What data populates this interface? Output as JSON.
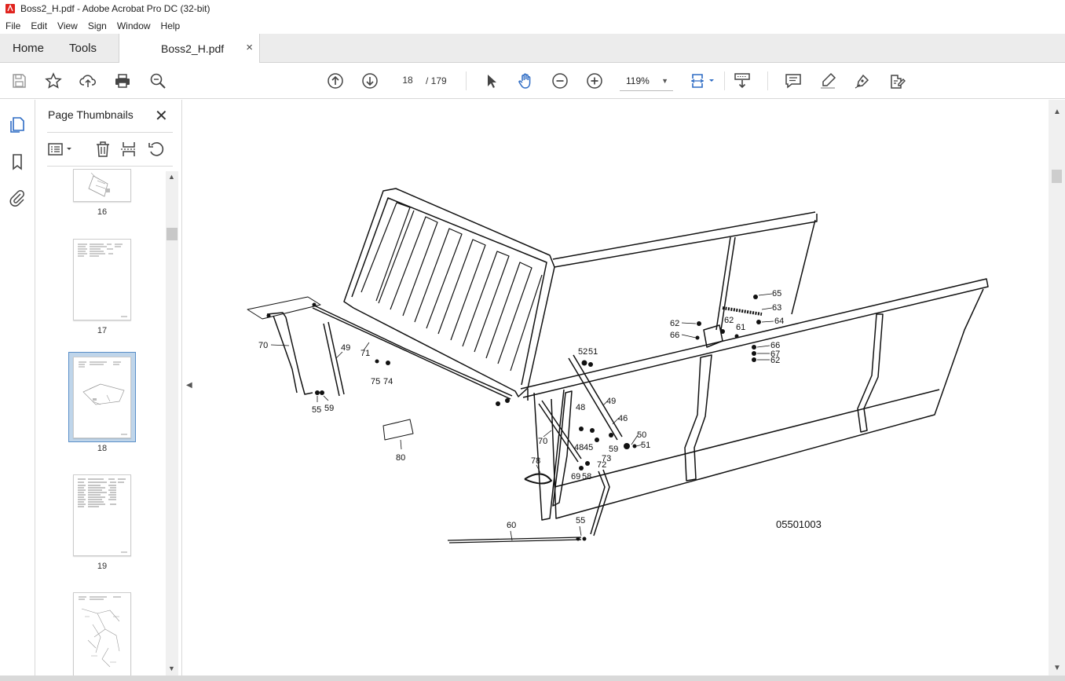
{
  "window": {
    "title": "Boss2_H.pdf - Adobe Acrobat Pro DC (32-bit)"
  },
  "menu": [
    "File",
    "Edit",
    "View",
    "Sign",
    "Window",
    "Help"
  ],
  "tabs": {
    "home": "Home",
    "tools": "Tools",
    "document": "Boss2_H.pdf",
    "close": "×"
  },
  "toolbar": {
    "page_current": "18",
    "page_total": "/ 179",
    "zoom": "119%",
    "icons": [
      "save-icon",
      "star-icon",
      "upload-icon",
      "print-icon",
      "search-icon",
      "arrow-up-circle-icon",
      "arrow-down-circle-icon",
      "select-arrow-icon",
      "hand-icon",
      "zoom-out-icon",
      "zoom-in-icon",
      "page-fit-icon",
      "scroll-mode-icon",
      "comment-icon",
      "highlight-icon",
      "sign-icon",
      "edit-pdf-icon"
    ]
  },
  "panel": {
    "title": "Page Thumbnails",
    "close": "✕",
    "thumbnails": [
      {
        "label": "16",
        "selected": false
      },
      {
        "label": "17",
        "selected": false
      },
      {
        "label": "18",
        "selected": true
      },
      {
        "label": "19",
        "selected": false
      },
      {
        "label": "",
        "selected": false
      }
    ]
  },
  "drawing": {
    "reference_code": "05501003",
    "part_labels": [
      "70",
      "49",
      "71",
      "75",
      "74",
      "55",
      "59",
      "80",
      "52",
      "51",
      "49",
      "48",
      "46",
      "45",
      "48",
      "50",
      "51",
      "59",
      "73",
      "72",
      "70",
      "78",
      "69",
      "58",
      "60",
      "55",
      "65",
      "63",
      "62",
      "62",
      "64",
      "66",
      "61",
      "66",
      "67",
      "62"
    ]
  }
}
